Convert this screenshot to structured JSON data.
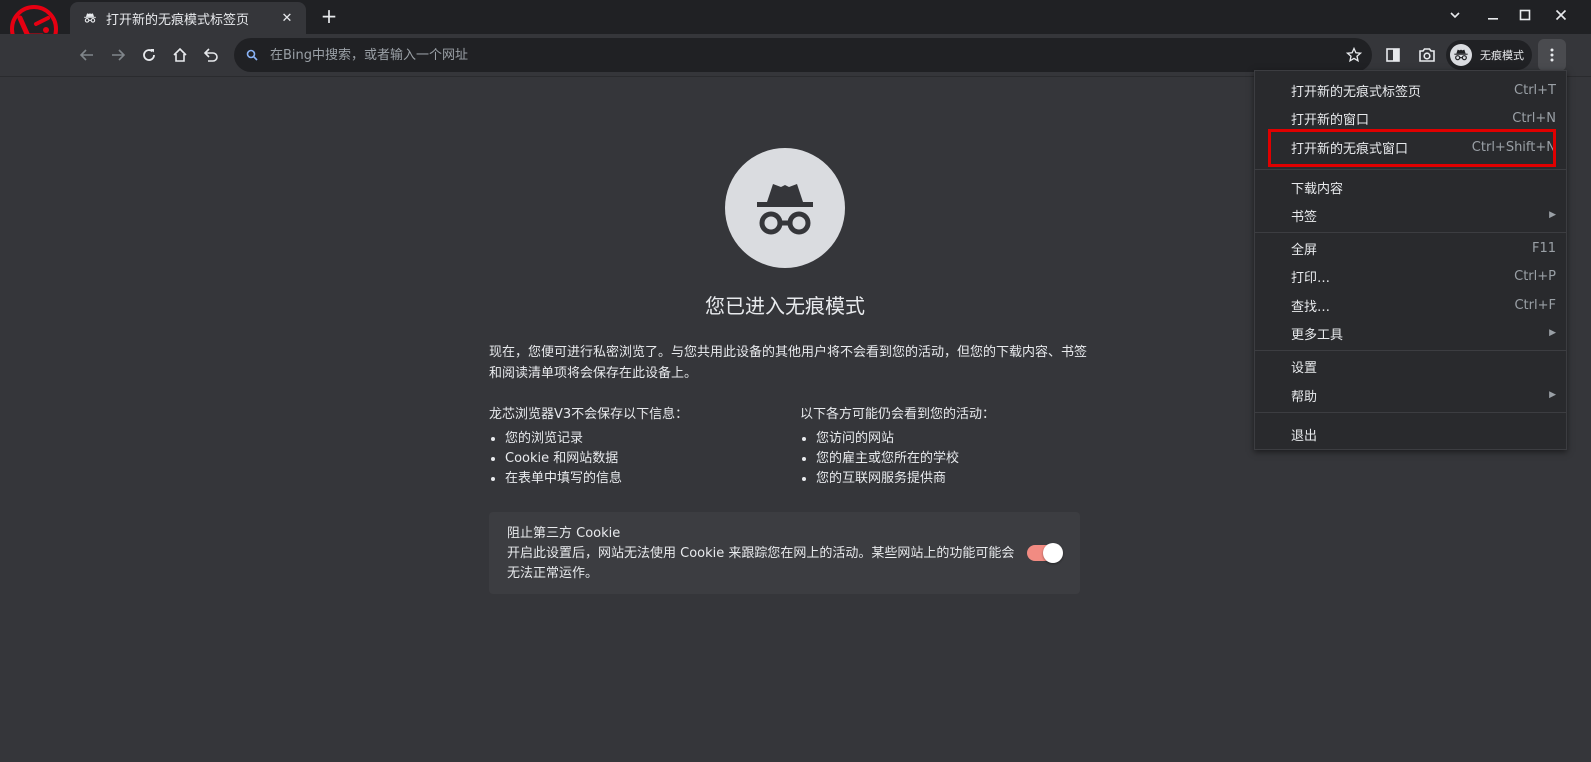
{
  "tab": {
    "title": "打开新的无痕模式标签页",
    "close": "✕"
  },
  "newtab": "+",
  "omnibox": {
    "placeholder": "在Bing中搜索，或者输入一个网址"
  },
  "profile": {
    "label": "无痕模式"
  },
  "page": {
    "heading": "您已进入无痕模式",
    "intro": "现在，您便可进行私密浏览了。与您共用此设备的其他用户将不会看到您的活动，但您的下载内容、书签和阅读清单项将会保存在此设备上。",
    "left_col": {
      "title": "龙芯浏览器V3不会保存以下信息：",
      "items": [
        "您的浏览记录",
        "Cookie 和网站数据",
        "在表单中填写的信息"
      ]
    },
    "right_col": {
      "title": "以下各方可能仍会看到您的活动：",
      "items": [
        "您访问的网站",
        "您的雇主或您所在的学校",
        "您的互联网服务提供商"
      ]
    },
    "cookie_card": {
      "title": "阻止第三方 Cookie",
      "desc": "开启此设置后，网站无法使用 Cookie 来跟踪您在网上的活动。某些网站上的功能可能会无法正常运作。"
    }
  },
  "menu": {
    "items": [
      {
        "label": "打开新的无痕式标签页",
        "shortcut": "Ctrl+T"
      },
      {
        "label": "打开新的窗口",
        "shortcut": "Ctrl+N"
      },
      {
        "label": "打开新的无痕式窗口",
        "shortcut": "Ctrl+Shift+N"
      },
      {
        "label": "下载内容",
        "shortcut": ""
      },
      {
        "label": "书签",
        "shortcut": ""
      },
      {
        "label": "全屏",
        "shortcut": "F11"
      },
      {
        "label": "打印…",
        "shortcut": "Ctrl+P"
      },
      {
        "label": "查找…",
        "shortcut": "Ctrl+F"
      },
      {
        "label": "更多工具",
        "shortcut": ""
      },
      {
        "label": "设置",
        "shortcut": ""
      },
      {
        "label": "帮助",
        "shortcut": ""
      },
      {
        "label": "退出",
        "shortcut": ""
      }
    ],
    "submenu_arrow": "▶"
  },
  "colors": {
    "background": "#35363a",
    "titlebar": "#202124",
    "highlight": "#e00000",
    "toggle_on": "#f28b82",
    "logo_red": "#e60012"
  }
}
